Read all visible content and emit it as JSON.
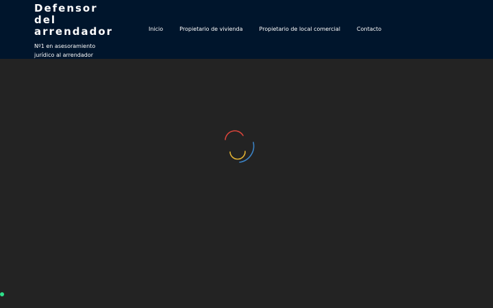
{
  "site": {
    "title": "Defensor del arrendador",
    "tagline": "Nº1 en asesoramiento jurídico al arrendador"
  },
  "nav": {
    "items": [
      {
        "label": "Inicio"
      },
      {
        "label": "Propietario de vivienda"
      },
      {
        "label": "Propietario de local comercial"
      },
      {
        "label": "Contacto"
      }
    ]
  },
  "loader": {
    "icon": "loading-spinner-icon",
    "colors": [
      "#d9443a",
      "#e2b233",
      "#3b82c4"
    ]
  },
  "status": {
    "icon": "status-dot-icon",
    "color": "#2ee08a"
  }
}
